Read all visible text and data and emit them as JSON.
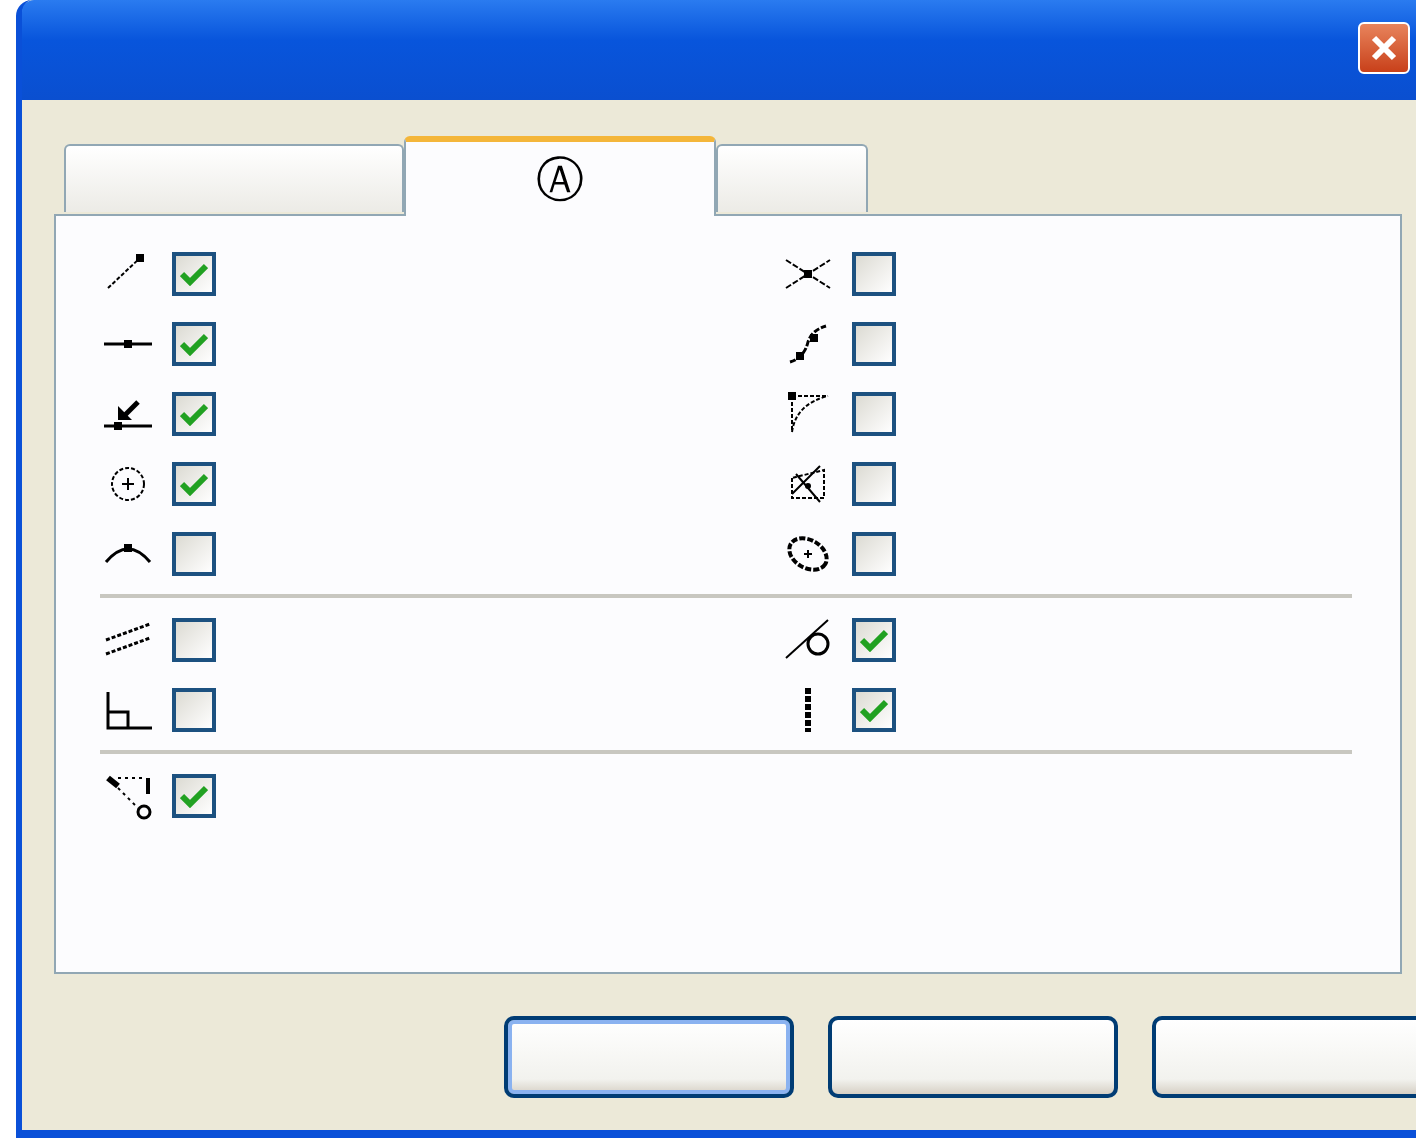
{
  "tabs": [
    {
      "selected": false
    },
    {
      "label": "Ⓐ",
      "selected": true
    },
    {
      "selected": false
    }
  ],
  "sections": [
    {
      "left": [
        {
          "checked": true
        },
        {
          "checked": true
        },
        {
          "checked": true
        },
        {
          "checked": true
        },
        {
          "checked": false
        }
      ],
      "right": [
        {
          "checked": false
        },
        {
          "checked": false
        },
        {
          "checked": false
        },
        {
          "checked": false
        },
        {
          "checked": false
        }
      ]
    },
    {
      "left": [
        {
          "checked": false
        },
        {
          "checked": false
        }
      ],
      "right": [
        {
          "checked": true
        },
        {
          "checked": true
        }
      ]
    },
    {
      "left": [
        {
          "checked": true
        }
      ]
    }
  ],
  "buttons": [
    {
      "default": true
    },
    {
      "default": false
    },
    {
      "default": false
    }
  ]
}
